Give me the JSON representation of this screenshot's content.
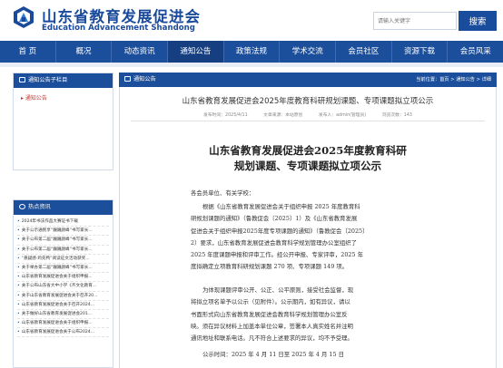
{
  "brand": {
    "name_cn": "山东省教育发展促进会",
    "name_en": "Education Advancement Shandong",
    "colors": {
      "primary": "#1b4f9c",
      "accent_red": "#c0392b"
    }
  },
  "search": {
    "placeholder": "请输入关键字",
    "button_label": "搜索"
  },
  "nav": {
    "items": [
      "首 页",
      "概况",
      "动态资讯",
      "通知公告",
      "政策法规",
      "学术交流",
      "会员社区",
      "资源下载",
      "会员风采"
    ],
    "active": "通知公告"
  },
  "sidebar": {
    "sub_column": {
      "title": "通知公告子栏目",
      "items": [
        "通知公告"
      ]
    },
    "hot": {
      "title": "热点资讯",
      "items": [
        "2024年书法作品大赛证书下载",
        "关于公示通民享“巍巍颜峰”书写家长...",
        "关于公布第二届“巍巍颜峰”书写家长...",
        "关于公布第二届“巍巍颜峰”书写家长...",
        "“悬疑感·鸡先鸭”阅读征文活动获奖...",
        "关于举办第二届“巍巍颜峰”书写家长...",
        "山东省教育发展促进会关于组织申报...",
        "关于公布山东省大中小学《齐文化教育...",
        "关于山东省教育发展促进会关于召开20...",
        "山东省教育发展促进会关于召开2024...",
        "关于做好山东省教育发展促进会201...",
        "山东省教育发展促进会关于组织申报...",
        "山东省教育发展促进会关于公布2024..."
      ]
    }
  },
  "main": {
    "section_title": "通知公告",
    "breadcrumb": "当前位置：首页 > 通知公告 > 详细",
    "article": {
      "title": "山东省教育发展促进会2025年度教育科研规划课题、专项课题拟立项公示",
      "meta": {
        "publish_time": "发布时间：2025/4/11",
        "source": "文章来源：本站原创",
        "author": "发布人：admin(管理员)",
        "views": "浏览次数：143"
      },
      "doc_title": [
        "山东省教育发展促进会2025年度教育科研",
        "规划课题、专项课题拟立项公示"
      ],
      "salutation": "各会员单位、有关学校：",
      "para1": [
        "根据《山东省教育发展促进会关于组织申报 2025 年度教育科",
        "研规划课题的通知》（鲁教促会〔2025〕1）及《山东省教育发展",
        "促进会关于组织申报2025年度专项课题的通知》（鲁教促会〔2025〕",
        "2）要求，山东省教育发展促进会教育科学规划管理办公室组织了",
        "2025 年度课题申报和评审工作。经公开申报、专家评审，2025 年",
        "度拟确定立项教育科研规划课题 270 项、专项课题 149 项。"
      ],
      "para2": [
        "为体现课题评审公开、公正、公平原则，接受社会监督，现",
        "将拟立项名单予以公示（见附件）。公示期内，如有异议，请以",
        "书面形式向山东省教育发展促进会教育科学规划管理办公室反",
        "映。须在异议材料上加盖本单位公章，签署本人真实姓名并注明",
        "通讯地址和联系电话。凡不符合上述要求的异议，均不予受理。"
      ],
      "publicity_period": "公示时间：2025 年 4 月 11 日至 2025 年 4 月 15 日"
    }
  }
}
